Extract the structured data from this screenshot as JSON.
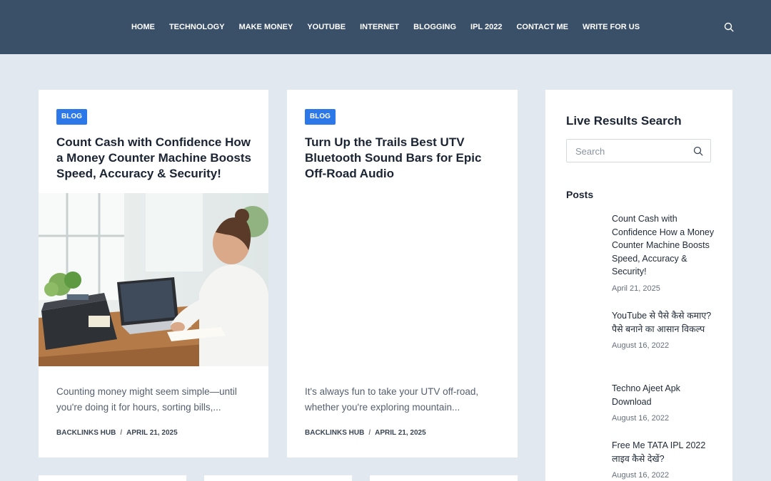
{
  "nav": {
    "items": [
      "HOME",
      "TECHNOLOGY",
      "MAKE MONEY",
      "YOUTUBE",
      "INTERNET",
      "BLOGGING",
      "IPL 2022",
      "CONTACT ME",
      "WRITE FOR US"
    ],
    "search_icon": "search-icon"
  },
  "cards": [
    {
      "badge": "BLOG",
      "title": "Count Cash with Confidence How a Money Counter Machine Boosts Speed, Accuracy & Security!",
      "excerpt": "Counting money might seem simple—until you're doing it for hours, sorting bills,...",
      "author": "BACKLINKS HUB",
      "separator": "/",
      "date": "APRIL 21, 2025"
    },
    {
      "badge": "BLOG",
      "title": "Turn Up the Trails Best UTV Bluetooth Sound Bars for Epic Off-Road Audio",
      "excerpt": "It's always fun to take your UTV off-road, whether you're exploring mountain...",
      "author": "BACKLINKS HUB",
      "separator": "/",
      "date": "APRIL 21, 2025"
    }
  ],
  "sidebar": {
    "heading": "Live Results Search",
    "search_placeholder": "Search",
    "posts_heading": "Posts",
    "posts": [
      {
        "title": "Count Cash with Confidence How a Money Counter Machine Boosts Speed, Accuracy & Security!",
        "date": "April 21, 2025"
      },
      {
        "title": "YouTube से पैसे कैसे कमाए? पैसे बनाने का आसान विकल्प",
        "date": "August 16, 2022"
      },
      {
        "title": "Techno Ajeet Apk Download",
        "date": "August 16, 2022"
      },
      {
        "title": "Free Me TATA IPL 2022 लाइव कैसे देखें?",
        "date": "August 16, 2022"
      }
    ]
  },
  "colors": {
    "header_bg": "#3a5069",
    "page_bg": "#e1e8ef",
    "badge_bg": "#2d78e8"
  }
}
